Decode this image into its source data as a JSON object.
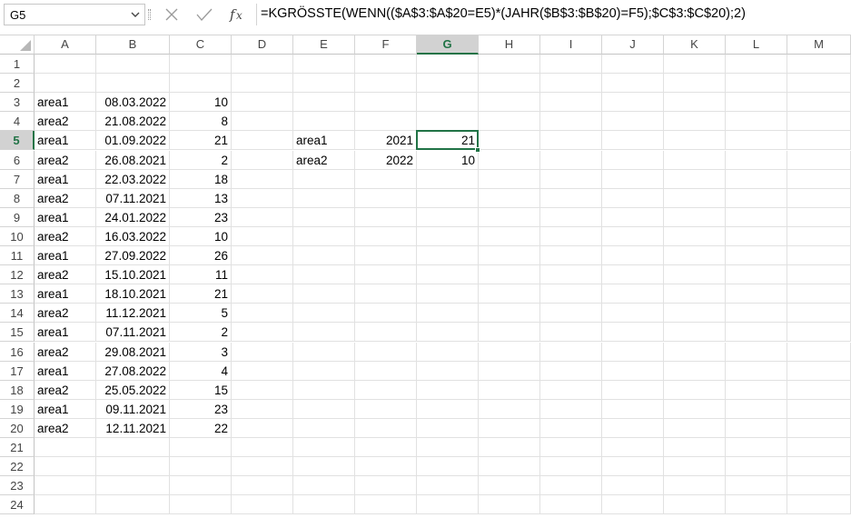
{
  "name_box": {
    "value": "G5"
  },
  "formula_bar": {
    "formula": "=KGRÖSSTE(WENN(($A$3:$A$20=E5)*(JAHR($B$3:$B$20)=F5);$C$3:$C$20);2)"
  },
  "icons": {
    "cancel": "close-icon",
    "enter": "check-icon",
    "function": "fx-icon",
    "dropdown": "chevron-down-icon"
  },
  "colors": {
    "accent": "#217346",
    "gridline": "#e1e1e1",
    "header_selected": "#d2d2d2"
  },
  "columns": [
    "A",
    "B",
    "C",
    "D",
    "E",
    "F",
    "G",
    "H",
    "I",
    "J",
    "K",
    "L",
    "M"
  ],
  "rows": [
    "1",
    "2",
    "3",
    "4",
    "5",
    "6",
    "7",
    "8",
    "9",
    "10",
    "11",
    "12",
    "13",
    "14",
    "15",
    "16",
    "17",
    "18",
    "19",
    "20",
    "21",
    "22",
    "23",
    "24"
  ],
  "active_cell": "G5",
  "cells": {
    "A3": "area1",
    "B3": "08.03.2022",
    "C3": "10",
    "A4": "area2",
    "B4": "21.08.2022",
    "C4": "8",
    "A5": "area1",
    "B5": "01.09.2022",
    "C5": "21",
    "A6": "area2",
    "B6": "26.08.2021",
    "C6": "2",
    "A7": "area1",
    "B7": "22.03.2022",
    "C7": "18",
    "A8": "area2",
    "B8": "07.11.2021",
    "C8": "13",
    "A9": "area1",
    "B9": "24.01.2022",
    "C9": "23",
    "A10": "area2",
    "B10": "16.03.2022",
    "C10": "10",
    "A11": "area1",
    "B11": "27.09.2022",
    "C11": "26",
    "A12": "area2",
    "B12": "15.10.2021",
    "C12": "11",
    "A13": "area1",
    "B13": "18.10.2021",
    "C13": "21",
    "A14": "area2",
    "B14": "11.12.2021",
    "C14": "5",
    "A15": "area1",
    "B15": "07.11.2021",
    "C15": "2",
    "A16": "area2",
    "B16": "29.08.2021",
    "C16": "3",
    "A17": "area1",
    "B17": "27.08.2022",
    "C17": "4",
    "A18": "area2",
    "B18": "25.05.2022",
    "C18": "15",
    "A19": "area1",
    "B19": "09.11.2021",
    "C19": "23",
    "A20": "area2",
    "B20": "12.11.2021",
    "C20": "22",
    "E5": "area1",
    "F5": "2021",
    "G5": "21",
    "E6": "area2",
    "F6": "2022",
    "G6": "10"
  }
}
